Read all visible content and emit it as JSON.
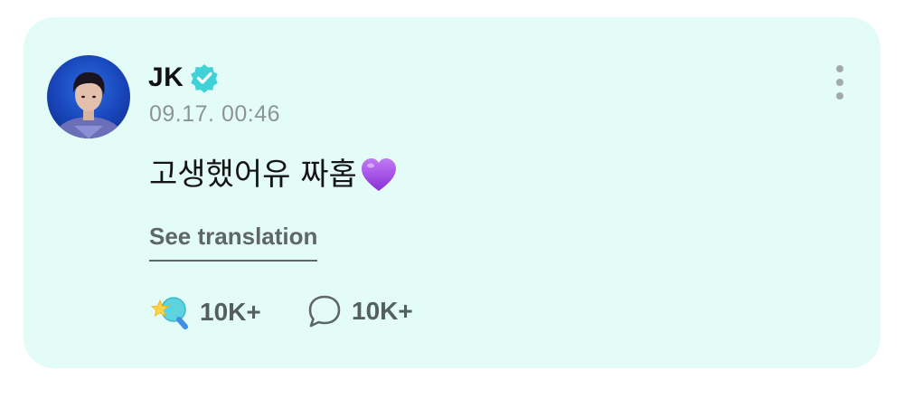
{
  "post": {
    "author": "JK",
    "verified": true,
    "timestamp": "09.17. 00:46",
    "text": "고생했어유 짜홉",
    "emoji": "purple-heart-icon",
    "see_translation_label": "See translation",
    "likes": "10K+",
    "comments": "10K+"
  },
  "colors": {
    "card_background": "#e4fcf7",
    "verified_badge": "#3fd3d8",
    "heart": "#a24de6",
    "muted_text": "#8c9594"
  }
}
